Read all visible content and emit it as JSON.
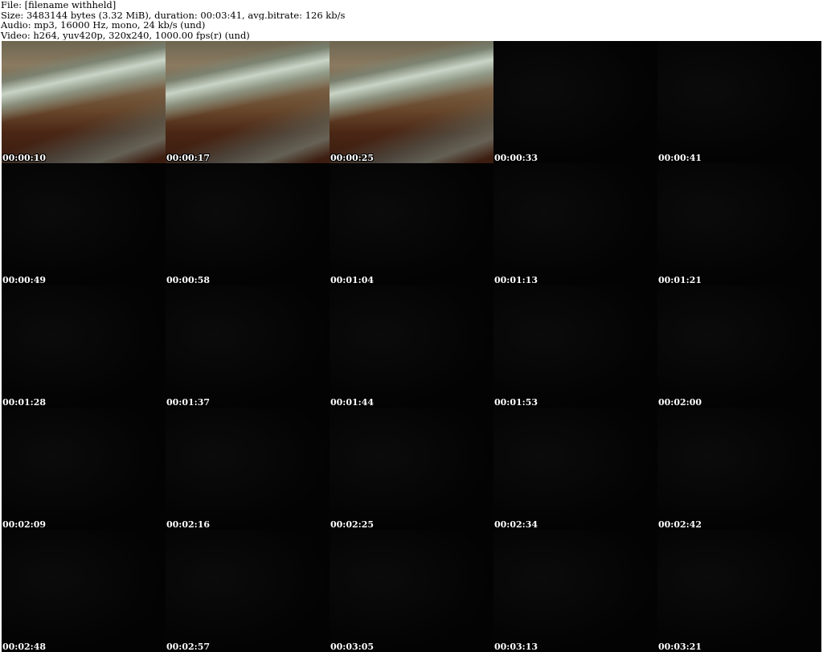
{
  "info": {
    "file": "File: [filename withheld]",
    "size": "Size: 3483144 bytes (3.32 MiB), duration: 00:03:41, avg.bitrate: 126 kb/s",
    "audio": "Audio: mp3, 16000 Hz, mono, 24 kb/s (und)",
    "video": "Video: h264, yuv420p, 320x240, 1000.00 fps(r) (und)"
  },
  "thumbnails": [
    {
      "timestamp": "00:00:10",
      "style": "blur"
    },
    {
      "timestamp": "00:00:17",
      "style": "blur"
    },
    {
      "timestamp": "00:00:25",
      "style": "blur"
    },
    {
      "timestamp": "00:00:33",
      "style": "dark"
    },
    {
      "timestamp": "00:00:41",
      "style": "dark"
    },
    {
      "timestamp": "00:00:49",
      "style": "dark"
    },
    {
      "timestamp": "00:00:58",
      "style": "dark"
    },
    {
      "timestamp": "00:01:04",
      "style": "dark"
    },
    {
      "timestamp": "00:01:13",
      "style": "dark"
    },
    {
      "timestamp": "00:01:21",
      "style": "dark"
    },
    {
      "timestamp": "00:01:28",
      "style": "dark"
    },
    {
      "timestamp": "00:01:37",
      "style": "dark"
    },
    {
      "timestamp": "00:01:44",
      "style": "dark"
    },
    {
      "timestamp": "00:01:53",
      "style": "dark"
    },
    {
      "timestamp": "00:02:00",
      "style": "dark"
    },
    {
      "timestamp": "00:02:09",
      "style": "dark"
    },
    {
      "timestamp": "00:02:16",
      "style": "dark"
    },
    {
      "timestamp": "00:02:25",
      "style": "dark"
    },
    {
      "timestamp": "00:02:34",
      "style": "dark"
    },
    {
      "timestamp": "00:02:42",
      "style": "dark"
    },
    {
      "timestamp": "00:02:48",
      "style": "dark"
    },
    {
      "timestamp": "00:02:57",
      "style": "dark"
    },
    {
      "timestamp": "00:03:05",
      "style": "dark"
    },
    {
      "timestamp": "00:03:13",
      "style": "dark"
    },
    {
      "timestamp": "00:03:21",
      "style": "dark"
    }
  ],
  "colors": {
    "background": "#ffffff",
    "sheet": "#000000",
    "timestamp_text": "#ffffff"
  }
}
